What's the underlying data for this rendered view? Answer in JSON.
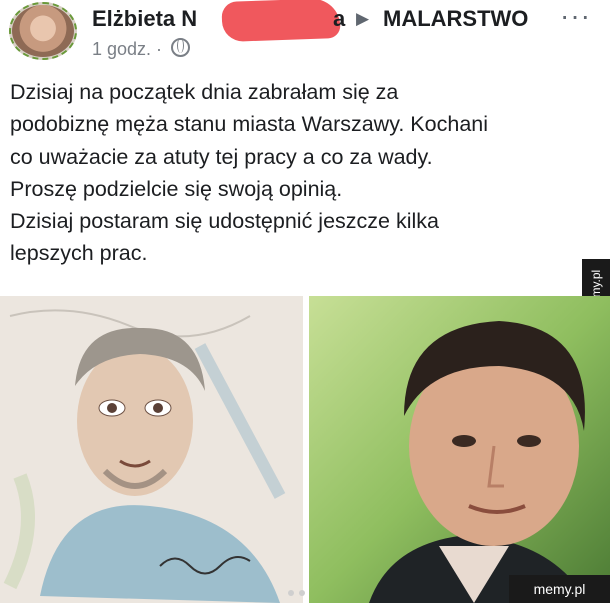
{
  "post": {
    "author": "Elżbieta N",
    "author_suffix": "a",
    "arrow": "▶",
    "group": "MALARSTWO",
    "more_icon": "more-horizontal-icon",
    "time": "1 godz. ·",
    "privacy_icon": "globe-icon",
    "lines": [
      "Dzisiaj na początek dnia zabrałam się za",
      "podobiznę męża stanu miasta Warszawy. Kochani",
      "co uważacie za atuty tej pracy a co za wady.",
      "Proszę podzielcie się swoją opinią.",
      "Dzisiaj postaram się udostępnić jeszcze kilka",
      "lepszych prac."
    ]
  },
  "watermark": {
    "side": "memy.pl",
    "bottom": "memy.pl"
  }
}
